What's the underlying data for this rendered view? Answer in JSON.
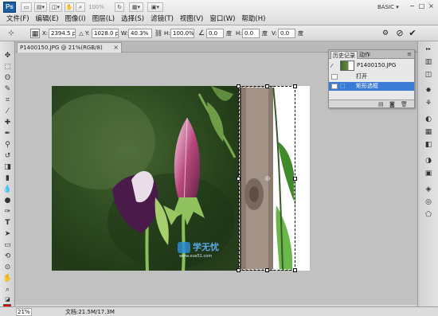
{
  "titlebar": {
    "logo": "Ps",
    "zoom_value": "100%",
    "workspace": "BASIC",
    "workspace_arrow": "▾",
    "window_controls": [
      "−",
      "□",
      "×"
    ]
  },
  "menu": [
    "文件(F)",
    "编辑(E)",
    "图像(I)",
    "图层(L)",
    "选择(S)",
    "滤镜(T)",
    "视图(V)",
    "窗口(W)",
    "帮助(H)"
  ],
  "options": {
    "x_label": "X:",
    "x_value": "2394.5 px",
    "y_label": "Y:",
    "y_value": "1028.0 px",
    "w_label": "W:",
    "w_value": "40.3%",
    "h_label": "H:",
    "h_value": "100.0%",
    "angle_value": "0.0",
    "angle_unit": "度",
    "hskew_label": "H:",
    "hskew_value": "0.0",
    "hskew_unit": "度",
    "vskew_label": "V:",
    "vskew_value": "0.0",
    "vskew_unit": "度",
    "cancel_icon": "⊘",
    "commit_icon": "✔"
  },
  "document": {
    "tab_title": "P1400150.JPG @ 21%(RGB/8)",
    "tab_close": "×"
  },
  "history": {
    "tabs": [
      "历史记录",
      "动作"
    ],
    "snapshot_name": "P1400150.JPG",
    "steps": [
      "打开",
      "矩形选框"
    ],
    "menu_icon": "≡"
  },
  "watermark": {
    "brand": "学无忧",
    "url": "www.xue51.com"
  },
  "status": {
    "zoom": "21%",
    "doc_info": "文档:21.5M/17.3M"
  },
  "colors": {
    "foreground": "#e00000",
    "background": "#ffffff",
    "selected_history": "#3a7bd5"
  }
}
